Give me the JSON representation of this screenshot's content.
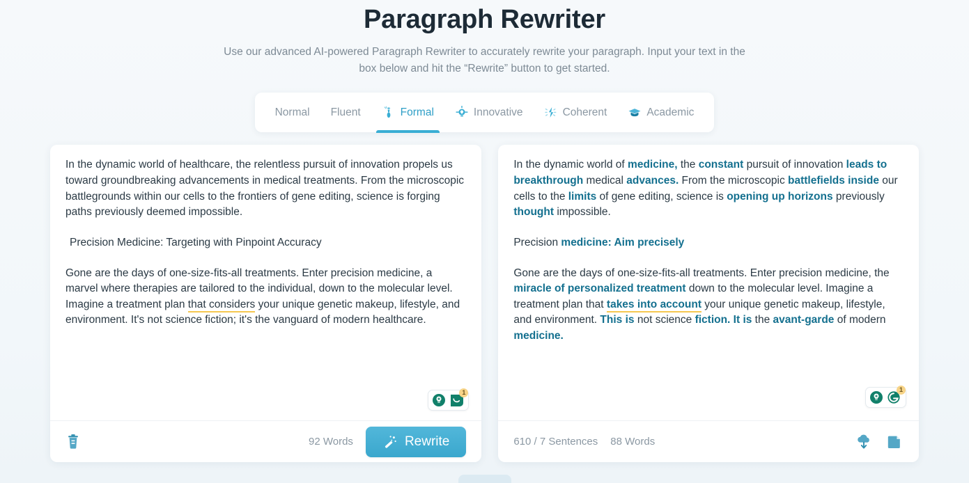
{
  "header": {
    "title": "Paragraph Rewriter",
    "subtitle": "Use our advanced AI-powered Paragraph Rewriter to accurately rewrite your paragraph. Input your text in the box below and hit the “Rewrite” button to get started."
  },
  "tabs": {
    "items": [
      {
        "label": "Normal",
        "icon": "none",
        "active": false
      },
      {
        "label": "Fluent",
        "icon": "none",
        "active": false
      },
      {
        "label": "Formal",
        "icon": "tie-icon",
        "active": true
      },
      {
        "label": "Innovative",
        "icon": "lightbulb-icon",
        "active": false
      },
      {
        "label": "Coherent",
        "icon": "sparkle-icon",
        "active": false
      },
      {
        "label": "Academic",
        "icon": "graduation-cap-icon",
        "active": false
      }
    ]
  },
  "input_panel": {
    "paragraphs": [
      {
        "indent": false,
        "runs": [
          {
            "text": "In the dynamic world of healthcare, the relentless pursuit of innovation propels us toward groundbreaking advancements in medical treatments. From the microscopic battlegrounds within our cells to the frontiers of gene editing, science is forging paths previously deemed impossible.",
            "style": "plain"
          }
        ]
      },
      {
        "indent": true,
        "runs": [
          {
            "text": "Precision Medicine: Targeting with Pinpoint Accuracy",
            "style": "plain"
          }
        ]
      },
      {
        "indent": false,
        "runs": [
          {
            "text": "Gone are the days of one-size-fits-all treatments. Enter precision medicine, a marvel where therapies are tailored to the individual, down to the molecular level. Imagine a treatment plan ",
            "style": "plain"
          },
          {
            "text": "that considers",
            "style": "underline"
          },
          {
            "text": " your unique genetic makeup, lifestyle, and environment. It's not science fiction; it's the vanguard of modern healthcare.",
            "style": "plain"
          }
        ]
      }
    ],
    "badge": {
      "name": "grammarly-badge",
      "count": "1"
    },
    "footer": {
      "clear_icon": "trash-icon",
      "word_count": "92 Words",
      "rewrite_label": "Rewrite",
      "rewrite_icon": "magic-wand-icon"
    }
  },
  "output_panel": {
    "paragraphs": [
      {
        "indent": false,
        "runs": [
          {
            "text": "In the dynamic world of ",
            "style": "plain"
          },
          {
            "text": "medicine,",
            "style": "hl"
          },
          {
            "text": " the ",
            "style": "plain"
          },
          {
            "text": "constant",
            "style": "hl"
          },
          {
            "text": " pursuit of innovation ",
            "style": "plain"
          },
          {
            "text": "leads to breakthrough",
            "style": "hl"
          },
          {
            "text": " medical ",
            "style": "plain"
          },
          {
            "text": "advances.",
            "style": "hl"
          },
          {
            "text": " From the microscopic ",
            "style": "plain"
          },
          {
            "text": "battlefields inside",
            "style": "hl"
          },
          {
            "text": " our cells to the ",
            "style": "plain"
          },
          {
            "text": "limits",
            "style": "hl"
          },
          {
            "text": " of gene editing, science is ",
            "style": "plain"
          },
          {
            "text": "opening up horizons",
            "style": "hl"
          },
          {
            "text": " previously ",
            "style": "plain"
          },
          {
            "text": "thought",
            "style": "hl"
          },
          {
            "text": " impossible.",
            "style": "plain"
          }
        ]
      },
      {
        "indent": false,
        "runs": [
          {
            "text": "Precision ",
            "style": "plain"
          },
          {
            "text": "medicine: Aim precisely",
            "style": "hl"
          }
        ]
      },
      {
        "indent": false,
        "runs": [
          {
            "text": "Gone are the days of one-size-fits-all treatments. Enter precision medicine, the ",
            "style": "plain"
          },
          {
            "text": "miracle of personalized treatment",
            "style": "hl"
          },
          {
            "text": " down to the molecular level. Imagine a treatment plan that ",
            "style": "plain"
          },
          {
            "text": "takes into account",
            "style": "hl-underline"
          },
          {
            "text": " your unique genetic makeup, lifestyle, and environment. ",
            "style": "plain"
          },
          {
            "text": "This is",
            "style": "hl"
          },
          {
            "text": " not science ",
            "style": "plain"
          },
          {
            "text": "fiction. It is",
            "style": "hl"
          },
          {
            "text": " the ",
            "style": "plain"
          },
          {
            "text": "avant-garde",
            "style": "hl"
          },
          {
            "text": " of modern ",
            "style": "plain"
          },
          {
            "text": "medicine.",
            "style": "hl"
          }
        ]
      }
    ],
    "badge": {
      "name": "grammarly-badge",
      "count": "1"
    },
    "footer": {
      "sentence_count": "610 / 7 Sentences",
      "word_count": "88 Words",
      "download_icon": "cloud-download-icon",
      "copy_icon": "copy-document-icon"
    }
  },
  "colors": {
    "accent": "#3aaed4",
    "highlight": "#14708f",
    "underline": "#f5c851",
    "page_bg": "#f5f8fa",
    "muted_text": "#8b98a3",
    "title_text": "#1d2b36",
    "grammarly_green": "#11806a",
    "badge_amber": "#f7d488"
  }
}
